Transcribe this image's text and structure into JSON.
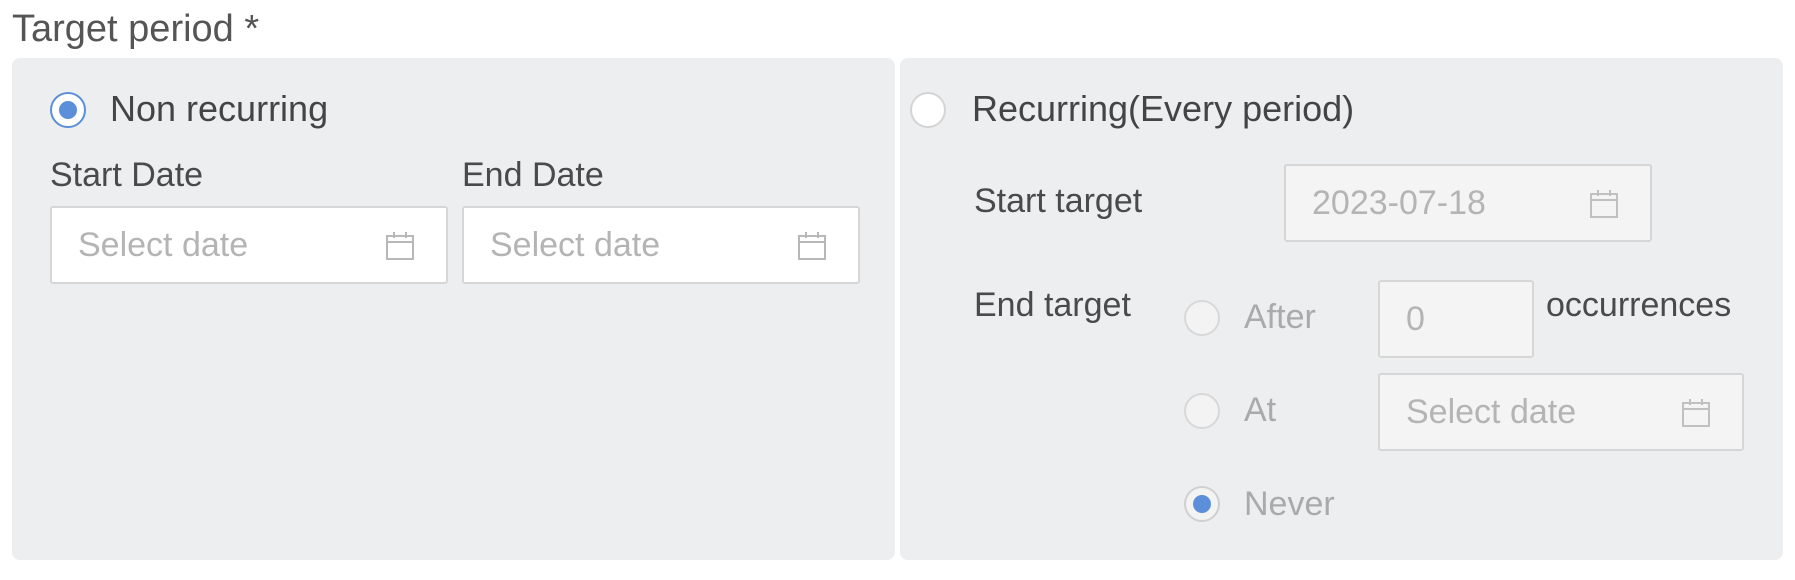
{
  "field": {
    "label": "Target period *"
  },
  "non_recurring": {
    "option_label": "Non recurring",
    "selected": true,
    "start_date": {
      "label": "Start Date",
      "placeholder": "Select date"
    },
    "end_date": {
      "label": "End Date",
      "placeholder": "Select date"
    }
  },
  "recurring": {
    "option_label": "Recurring(Every period)",
    "selected": false,
    "start_target": {
      "label": "Start target",
      "value": "2023-07-18"
    },
    "end_target": {
      "label": "End target",
      "after": {
        "label": "After",
        "value": "0",
        "suffix": "occurrences"
      },
      "at": {
        "label": "At",
        "placeholder": "Select date"
      },
      "never": {
        "label": "Never",
        "selected": true
      }
    }
  },
  "icons": {
    "calendar": "calendar-icon"
  },
  "colors": {
    "accent": "#5b8fd9",
    "panel_bg": "#edeef0",
    "disabled_text": "#aaaaaa"
  }
}
